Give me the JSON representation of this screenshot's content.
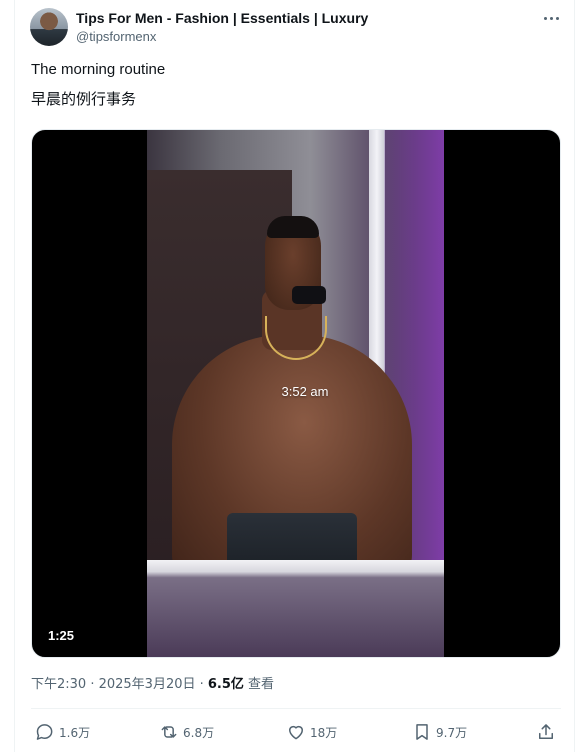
{
  "author": {
    "name": "Tips For Men - Fashion | Essentials | Luxury",
    "handle": "@tipsformenx"
  },
  "post": {
    "line1": "The morning routine",
    "line2": "早晨的例行事务"
  },
  "media": {
    "overlay_time": "3:52 am",
    "duration": "1:25"
  },
  "meta": {
    "timestamp": "下午2:30 · 2025年3月20日 · ",
    "views": "6.5亿",
    "views_label": " 查看"
  },
  "actions": {
    "replies": "1.6万",
    "reposts": "6.8万",
    "likes": "18万",
    "bookmarks": "9.7万"
  },
  "icons": [
    "more-icon",
    "reply-icon",
    "repost-icon",
    "like-icon",
    "bookmark-icon",
    "share-icon"
  ]
}
